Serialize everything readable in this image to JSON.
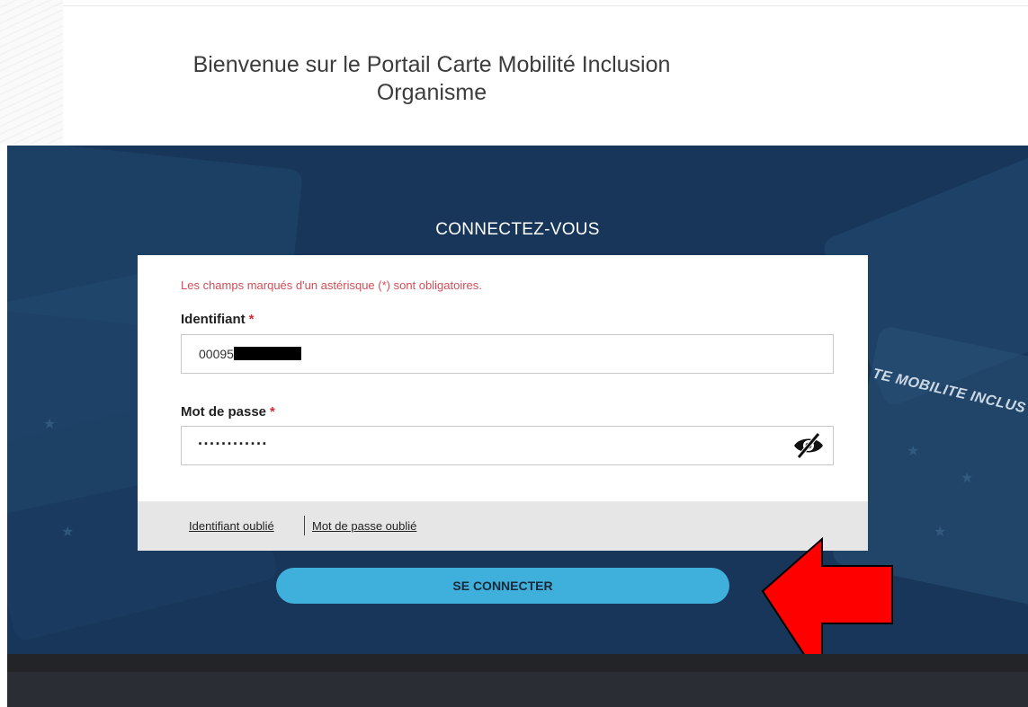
{
  "header": {
    "title_line1": "Bienvenue sur le Portail Carte Mobilité Inclusion",
    "title_line2": "Organisme"
  },
  "hero": {
    "card_text": "TE MOBILITE INCLUS"
  },
  "login": {
    "title": "CONNECTEZ-VOUS",
    "required_note": "Les champs marqués d'un astérisque (*) sont obligatoires.",
    "identifiant_label": "Identifiant",
    "identifiant_value": "00095",
    "password_label": "Mot de passe",
    "password_value": "············",
    "required_star": "*",
    "forgot_id": "Identifiant oublié",
    "forgot_password": "Mot de passe oublié",
    "submit_label": "SE CONNECTER"
  },
  "icons": {
    "eye": "eye-slash-icon",
    "arrow": "red-arrow-annotation"
  },
  "colors": {
    "hero_bg": "#17365a",
    "button": "#3fb0dc",
    "required": "#d24d57",
    "arrow": "#ff0000"
  }
}
